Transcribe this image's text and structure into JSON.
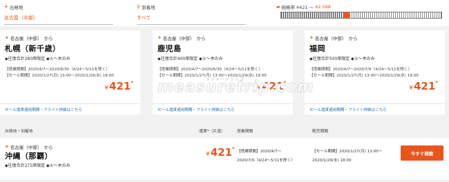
{
  "filter": {
    "from_label": "出発地",
    "from_value": "名古屋（中部）",
    "to_label": "到着地",
    "to_value": "すべて",
    "price_label": "価格帯 ¥421 ～",
    "price_max": "¥2,588",
    "price_level": 0.41
  },
  "cards": [
    {
      "from": "名古屋（中部）　から",
      "dest": "札幌（新千歳）",
      "seat": "◆往復合計280席限定 ◆火～木のみ",
      "period1": "【搭乗期間】2020/4/7～2020/6/30（4/24～5/11を除く）",
      "period2": "【セール期間】2020/1/27(月) 13:00～2020/1/29(水) 18:00",
      "yen": "¥",
      "price": "421",
      "ast": "*",
      "link": "セール運賃適用期間・フライト詳細はこちら"
    },
    {
      "from": "名古屋（中部）　から",
      "dest": "鹿児島",
      "seat": "◆往復合計400席限定 ◆火～木のみ",
      "period1": "【搭乗期間】2020/4/7～2020/6/30（4/24～5/11を除く）",
      "period2": "【セール期間】2020/1/27(月) 13:00～2020/1/29(水) 18:00",
      "yen": "¥",
      "price": "421",
      "ast": "*",
      "link": "セール運賃適用期間・フライト詳細はこちら"
    },
    {
      "from": "名古屋（中部）　から",
      "dest": "福岡",
      "seat": "◆往復合計500席限定 ◆火～木のみ",
      "period1": "【搭乗期間】2020/4/7～2020/7/9（4/24～5/11を除く）",
      "period2": "【セール期間】2020/1/27(月) 13:00～2020/1/29(水) 18:00",
      "yen": "¥",
      "price": "421",
      "ast": "*",
      "link": "セール運賃適用期間・フライト詳細はこちら"
    }
  ],
  "list_header": {
    "route": "出発地・到着地",
    "fare": "運賃*（片道）",
    "boarding": "搭乗期間",
    "sale": "販売期間"
  },
  "row": {
    "from": "名古屋（中部）　から",
    "dest": "沖縄（那覇）",
    "seat": "◆往復合計275席限定 ◆火～木のみ",
    "yen": "¥",
    "price": "421",
    "ast": "*",
    "boarding1": "【搭乗期間】2020/4/7～",
    "boarding2": "2020/7/9（4/24～5/11を除く）",
    "sale1": "【セール期間】2020/1/27(月) 13:00～",
    "sale2": "2020/1/29(水) 18:00",
    "button": "今すぐ検索"
  },
  "watermark": {
    "small": "メジャートリップ",
    "big": "measuretrip.com"
  },
  "colors": {
    "accent": "#e8561c",
    "link": "#1f6fb5"
  }
}
